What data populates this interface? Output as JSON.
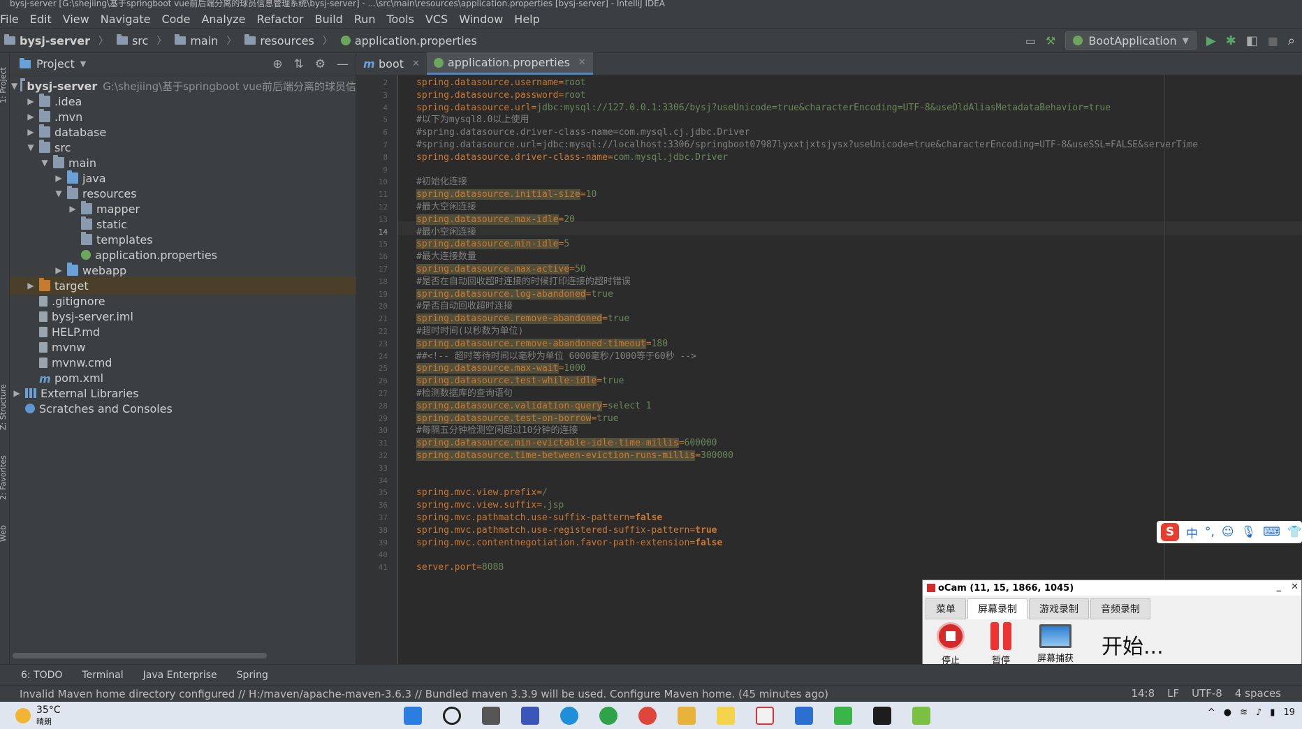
{
  "window": {
    "title": "bysj-server [G:\\shejiing\\基于springboot vue前后端分离的球员信息管理系统\\bysj-server] - ...\\src\\main\\resources\\application.properties [bysj-server] - IntelliJ IDEA"
  },
  "menu": [
    "File",
    "Edit",
    "View",
    "Navigate",
    "Code",
    "Analyze",
    "Refactor",
    "Build",
    "Run",
    "Tools",
    "VCS",
    "Window",
    "Help"
  ],
  "breadcrumb": [
    "bysj-server",
    "src",
    "main",
    "resources",
    "application.properties"
  ],
  "run_config": "BootApplication",
  "project_panel": {
    "title": "Project",
    "root_label": "bysj-server",
    "root_path": "G:\\shejiing\\基于springboot vue前后端分离的球员信",
    "items": [
      {
        "label": ".idea"
      },
      {
        "label": ".mvn"
      },
      {
        "label": "database"
      },
      {
        "label": "src"
      },
      {
        "label": "main"
      },
      {
        "label": "java"
      },
      {
        "label": "resources"
      },
      {
        "label": "mapper"
      },
      {
        "label": "static"
      },
      {
        "label": "templates"
      },
      {
        "label": "application.properties"
      },
      {
        "label": "webapp"
      },
      {
        "label": "target"
      },
      {
        "label": ".gitignore"
      },
      {
        "label": "bysj-server.iml"
      },
      {
        "label": "HELP.md"
      },
      {
        "label": "mvnw"
      },
      {
        "label": "mvnw.cmd"
      },
      {
        "label": "pom.xml"
      },
      {
        "label": "External Libraries"
      },
      {
        "label": "Scratches and Consoles"
      }
    ]
  },
  "editor": {
    "tabs": [
      "boot",
      "application.properties"
    ],
    "current_line": "14",
    "line_numbers": [
      "2",
      "3",
      "4",
      "5",
      "6",
      "7",
      "8",
      "9",
      "10",
      "11",
      "12",
      "13",
      "14",
      "15",
      "16",
      "17",
      "18",
      "19",
      "20",
      "21",
      "22",
      "23",
      "24",
      "25",
      "26",
      "27",
      "28",
      "29",
      "30",
      "31",
      "32",
      "33",
      "34",
      "35",
      "36",
      "37",
      "38",
      "39",
      "40",
      "41"
    ],
    "lines": [
      {
        "k": "spring.datasource.username",
        "e": "=",
        "v": "root"
      },
      {
        "k": "spring.datasource.password",
        "e": "=",
        "v": "root"
      },
      {
        "k": "spring.datasource.url",
        "e": "=",
        "v": "jdbc:mysql://127.0.0.1:3306/bysj?useUnicode=true&characterEncoding=UTF-8&useOldAliasMetadataBehavior=true"
      },
      {
        "c": "#以下为mysql8.0以上使用"
      },
      {
        "c": "#spring.datasource.driver-class-name=com.mysql.cj.jdbc.Driver"
      },
      {
        "c": "#spring.datasource.url=jdbc:mysql://localhost:3306/springboot07987lyxxtjxtsjysx?useUnicode=true&characterEncoding=UTF-8&useSSL=FALSE&serverTime"
      },
      {
        "k": "spring.datasource.driver-class-name",
        "e": "=",
        "v": "com.mysql.jdbc.Driver"
      },
      {},
      {
        "c": "#初始化连接"
      },
      {
        "h": "spring.datasource.initial-size",
        "e": "=",
        "v": "10"
      },
      {
        "c": "#最大空闲连接"
      },
      {
        "h": "spring.datasource.max-idle",
        "e": "=",
        "v": "20"
      },
      {
        "c": "#最小空闲连接"
      },
      {
        "h": "spring.datasource.min-idle",
        "e": "=",
        "v": "5"
      },
      {
        "c": "#最大连接数量"
      },
      {
        "h": "spring.datasource.max-active",
        "e": "=",
        "v": "50"
      },
      {
        "c": "#是否在自动回收超时连接的时候打印连接的超时错误"
      },
      {
        "h": "spring.datasource.log-abandoned",
        "e": "=",
        "v": "true"
      },
      {
        "c": "#是否自动回收超时连接"
      },
      {
        "h": "spring.datasource.remove-abandoned",
        "e": "=",
        "v": "true"
      },
      {
        "c": "#超时时间(以秒数为单位)"
      },
      {
        "h": "spring.datasource.remove-abandoned-timeout",
        "e": "=",
        "v": "180"
      },
      {
        "c": "##<!-- 超时等待时间以毫秒为单位 6000毫秒/1000等于60秒 -->"
      },
      {
        "h": "spring.datasource.max-wait",
        "e": "=",
        "v": "1000"
      },
      {
        "h": "spring.datasource.test-while-idle",
        "e": "=",
        "v": "true"
      },
      {
        "c": "#检测数据库的查询语句"
      },
      {
        "h": "spring.datasource.validation-query",
        "e": "=",
        "v": "select 1"
      },
      {
        "h": "spring.datasource.test-on-borrow",
        "e": "=",
        "v": "true"
      },
      {
        "c": "#每隔五分钟检测空闲超过10分钟的连接"
      },
      {
        "h": "spring.datasource.min-evictable-idle-time-millis",
        "e": "=",
        "v": "600000"
      },
      {
        "h": "spring.datasource.time-between-eviction-runs-millis",
        "e": "=",
        "v": "300000"
      },
      {},
      {},
      {
        "k": "spring.mvc.view.prefix",
        "e": "=",
        "v": "/"
      },
      {
        "k": "spring.mvc.view.suffix",
        "e": "=",
        "v": ".jsp"
      },
      {
        "k": "spring.mvc.pathmatch.use-suffix-pattern",
        "e": "=",
        "v": "false",
        "b": true
      },
      {
        "k": "spring.mvc.pathmatch.use-registered-suffix-pattern",
        "e": "=",
        "v": "true",
        "b": true
      },
      {
        "k": "spring.mvc.contentnegotiation.favor-path-extension",
        "e": "=",
        "v": "false",
        "b": true
      },
      {},
      {
        "k": "server.port",
        "e": "=",
        "v": "8088"
      }
    ]
  },
  "bottom_tools": [
    "6: TODO",
    "Terminal",
    "Java Enterprise",
    "Spring"
  ],
  "status": {
    "message": "Invalid Maven home directory configured // H:/maven/apache-maven-3.6.3 // Bundled maven 3.3.9 will be used.  Configure Maven home.  (45 minutes ago)",
    "position": "14:8",
    "line_sep": "LF",
    "encoding": "UTF-8",
    "indent": "4 spaces"
  },
  "ocam": {
    "title": "oCam (11, 15, 1866, 1045)",
    "tabs": [
      "菜单",
      "屏幕录制",
      "游戏录制",
      "音频录制"
    ],
    "stop": "停止",
    "pause": "暂停",
    "capture": "屏幕捕获",
    "start_text": "开始..."
  },
  "ime": {
    "logo": "S",
    "mode": "中"
  },
  "taskbar": {
    "temp": "35°C",
    "weather": "晴朗",
    "clock": "19"
  },
  "side_tabs": [
    "1: Project",
    "Z: Structure",
    "2: Favorites",
    "Web"
  ]
}
